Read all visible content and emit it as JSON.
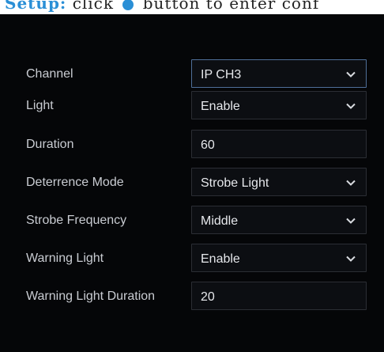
{
  "header": {
    "setup_label": "Setup:",
    "instruction_text": "click      button to enter conf",
    "settings_icon": "gear-icon"
  },
  "form": {
    "fields": [
      {
        "label": "Channel",
        "type": "select",
        "value": "IP CH3",
        "focused": true
      },
      {
        "label": "Light",
        "type": "select",
        "value": "Enable"
      },
      {
        "label": "Duration",
        "type": "input",
        "value": "60"
      },
      {
        "label": "Deterrence Mode",
        "type": "select",
        "value": "Strobe Light"
      },
      {
        "label": "Strobe Frequency",
        "type": "select",
        "value": "Middle"
      },
      {
        "label": "Warning Light",
        "type": "select",
        "value": "Enable"
      },
      {
        "label": "Warning Light Duration",
        "type": "input",
        "value": "20"
      }
    ]
  },
  "colors": {
    "panel_bg": "#050608",
    "accent": "#2a8fd6"
  }
}
